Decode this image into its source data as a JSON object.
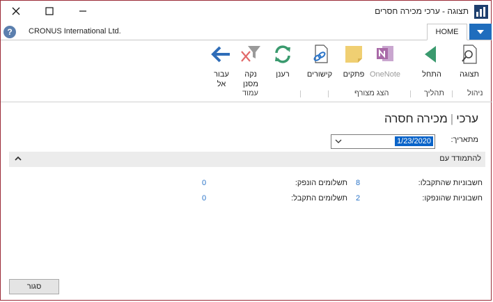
{
  "window": {
    "title": "תצוגה - ערכי מכירה חסרים"
  },
  "header": {
    "company": "CRONUS International Ltd.",
    "tab_home": "HOME"
  },
  "ribbon": {
    "buttons": {
      "view": "תצוגה",
      "start": "התחל",
      "onenote": "OneNote",
      "notes": "פתקים",
      "links": "קישורים",
      "refresh": "רענן",
      "clear_filter_l1": "נקה",
      "clear_filter_l2": "מסנן",
      "goto_l1": "עבור",
      "goto_l2": "אל"
    },
    "groups": {
      "manage": "ניהול",
      "process": "תהליך",
      "show_attached": "הצג מצורף",
      "page": "עמוד"
    }
  },
  "page": {
    "title_part1": "ערכי",
    "title_part2": "מכירה חסרה"
  },
  "filter": {
    "date_label": "מתאריך:",
    "date_value": "1/23/2020"
  },
  "fasttab": {
    "title": "להתמודד עם"
  },
  "cues": [
    {
      "label": "חשבוניות שהתקבלו:",
      "value": "8"
    },
    {
      "label": "תשלומים הונפק:",
      "value": "0"
    },
    {
      "label": "חשבוניות שהונפקו:",
      "value": "2"
    },
    {
      "label": "תשלומים התקבל:",
      "value": "0"
    }
  ],
  "footer": {
    "close_label": "סגור"
  },
  "colors": {
    "accent_blue": "#1f6dbd",
    "link_blue": "#2a74c8",
    "window_border": "#9a2a36"
  }
}
